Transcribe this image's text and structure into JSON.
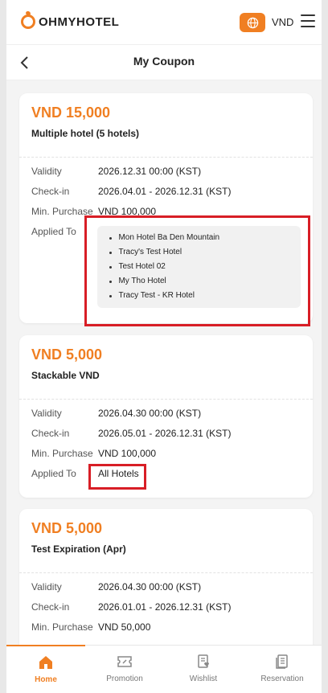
{
  "header": {
    "logo_text": "OHMYHOTEL",
    "currency": "VND",
    "icons": [
      "globe-icon",
      "menu-icon"
    ],
    "accent_color": "#f07f22"
  },
  "page": {
    "title": "My Coupon"
  },
  "coupons": [
    {
      "amount": "VND 15,000",
      "name": "Multiple hotel (5 hotels)",
      "rows": [
        {
          "label": "Validity",
          "value": "2026.12.31 00:00 (KST)"
        },
        {
          "label": "Check-in",
          "value": "2026.04.01 - 2026.12.31 (KST)"
        },
        {
          "label": "Min. Purchase",
          "value": "VND 100,000"
        },
        {
          "label": "Applied To",
          "value": ""
        }
      ],
      "hotels": [
        "Mon Hotel Ba Den Mountain",
        "Tracy's Test Hotel",
        "Test Hotel 02",
        "My Tho Hotel",
        "Tracy Test - KR Hotel"
      ]
    },
    {
      "amount": "VND 5,000",
      "name": "Stackable VND",
      "rows": [
        {
          "label": "Validity",
          "value": "2026.04.30 00:00 (KST)"
        },
        {
          "label": "Check-in",
          "value": "2026.05.01 - 2026.12.31 (KST)"
        },
        {
          "label": "Min. Purchase",
          "value": "VND 100,000"
        },
        {
          "label": "Applied To",
          "value": "All Hotels"
        }
      ]
    },
    {
      "amount": "VND 5,000",
      "name": "Test Expiration (Apr)",
      "rows": [
        {
          "label": "Validity",
          "value": "2026.04.30 00:00 (KST)"
        },
        {
          "label": "Check-in",
          "value": "2026.01.01 - 2026.12.31 (KST)"
        },
        {
          "label": "Min. Purchase",
          "value": "VND 50,000"
        }
      ]
    }
  ],
  "tabbar": [
    {
      "label": "Home",
      "icon": "home-icon",
      "active": true
    },
    {
      "label": "Promotion",
      "icon": "promotion-icon",
      "active": false
    },
    {
      "label": "Wishlist",
      "icon": "wishlist-icon",
      "active": false
    },
    {
      "label": "Reservation",
      "icon": "reservation-icon",
      "active": false
    }
  ]
}
